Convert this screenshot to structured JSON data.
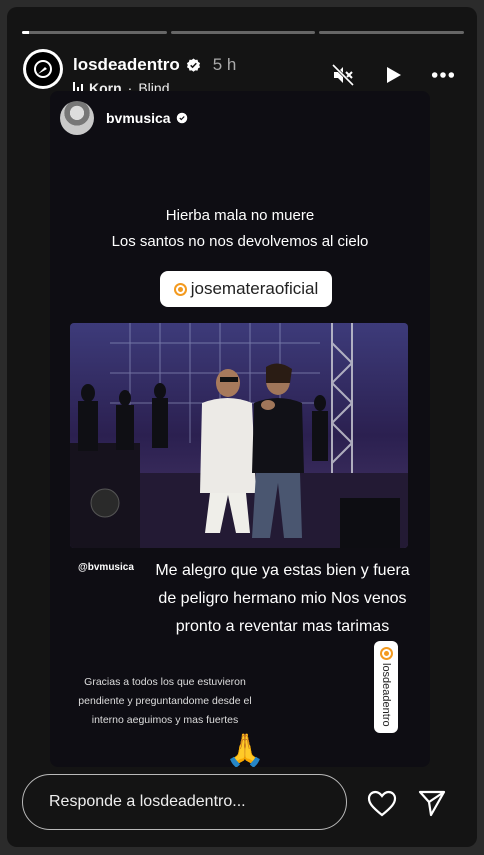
{
  "story": {
    "progress": [
      0.05,
      0,
      0
    ],
    "username": "losdeadentro",
    "time": "5 h",
    "music": {
      "artist": "Korn",
      "song": "Blind",
      "separator": " · "
    }
  },
  "repost": {
    "username": "bvmusica",
    "quote_line1": "Hierba mala no muere",
    "quote_line2": "Los santos no nos devolvemos al cielo",
    "mention": "josemateraoficial",
    "side_tag": "@bvmusica",
    "message": "Me alegro que ya estas bien y fuera de peligro hermano mio Nos venos pronto a reventar mas tarimas",
    "small_message": "Gracias a todos los que estuvieron pendiente y preguntandome desde el interno aeguimos y mas fuertes",
    "vertical_mention": "losdeadentro",
    "emoji": "🙏"
  },
  "footer": {
    "reply_placeholder": "Responde a losdeadentro..."
  },
  "icons": [
    "mute-icon",
    "play-icon",
    "more-icon",
    "heart-icon",
    "send-icon",
    "verified-icon",
    "music-bars-icon"
  ],
  "colors": {
    "accent_instagram": "#f39a1f",
    "background": "#141414"
  }
}
